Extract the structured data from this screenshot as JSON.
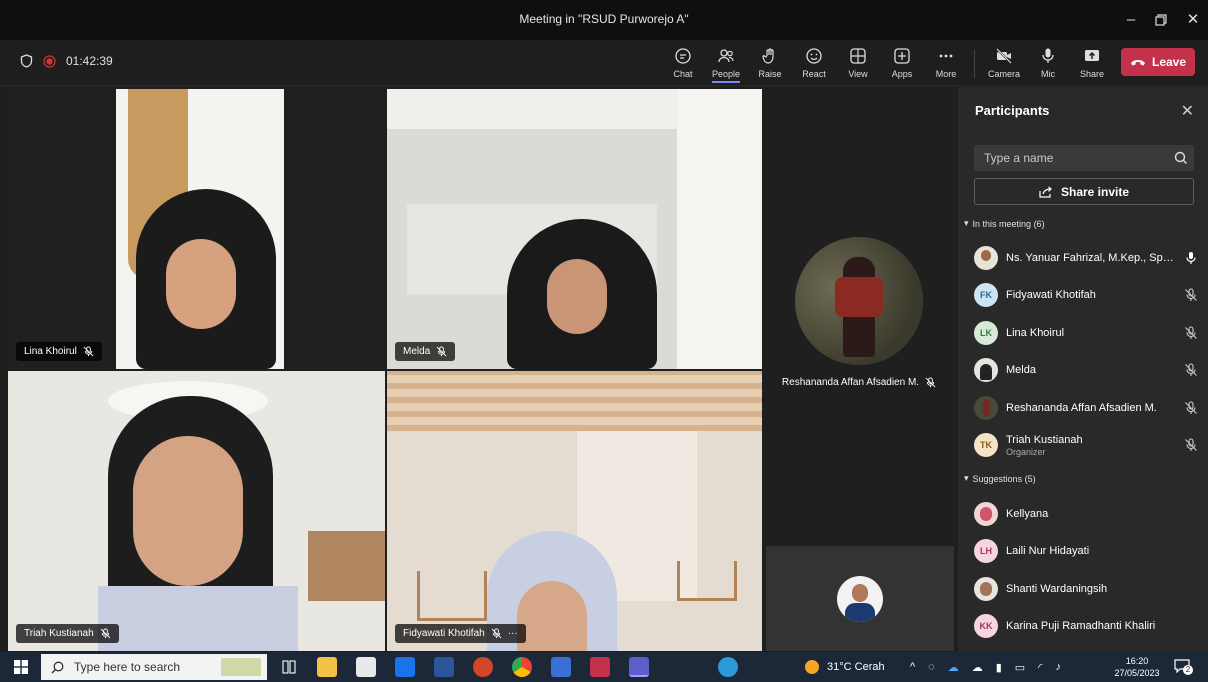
{
  "window": {
    "title": "Meeting in \"RSUD Purworejo A\""
  },
  "recording": {
    "time": "01:42:39"
  },
  "toolbar": {
    "chat": "Chat",
    "people": "People",
    "raise": "Raise",
    "react": "React",
    "view": "View",
    "apps": "Apps",
    "more": "More",
    "camera": "Camera",
    "mic": "Mic",
    "share": "Share",
    "leave": "Leave"
  },
  "tiles": {
    "lina": "Lina Khoirul",
    "melda": "Melda",
    "triah": "Triah Kustianah",
    "fidyawati": "Fidyawati Khotifah",
    "fidyawati_more": "···",
    "reshananda": "Reshananda Affan Afsadien M."
  },
  "panel": {
    "title": "Participants",
    "search_placeholder": "Type a name",
    "share_invite": "Share invite",
    "in_meeting": "In this meeting (6)",
    "suggestions": "Suggestions (5)",
    "participants": [
      {
        "name": "Ns. Yanuar Fahrizal, M.Kep., Sp.K...",
        "initials": "",
        "role": "",
        "mic": "on"
      },
      {
        "name": "Fidyawati Khotifah",
        "initials": "FK",
        "role": "",
        "mic": "muted"
      },
      {
        "name": "Lina Khoirul",
        "initials": "LK",
        "role": "",
        "mic": "muted"
      },
      {
        "name": "Melda",
        "initials": "",
        "role": "",
        "mic": "muted"
      },
      {
        "name": "Reshananda Affan Afsadien M.",
        "initials": "",
        "role": "",
        "mic": "muted"
      },
      {
        "name": "Triah Kustianah",
        "initials": "TK",
        "role": "Organizer",
        "mic": "muted"
      }
    ],
    "suggested": [
      {
        "name": "Kellyana",
        "initials": ""
      },
      {
        "name": "Laili Nur Hidayati",
        "initials": "LH"
      },
      {
        "name": "Shanti Wardaningsih",
        "initials": ""
      },
      {
        "name": "Karina Puji Ramadhanti Khaliri",
        "initials": "KK"
      }
    ]
  },
  "taskbar": {
    "search_placeholder": "Type here to search",
    "weather": "31°C  Cerah",
    "time": "16:20",
    "date": "27/05/2023",
    "notifications": "2"
  },
  "colors": {
    "accent": "#7f85f5",
    "leave": "#c4314b",
    "recording": "#d13438"
  }
}
